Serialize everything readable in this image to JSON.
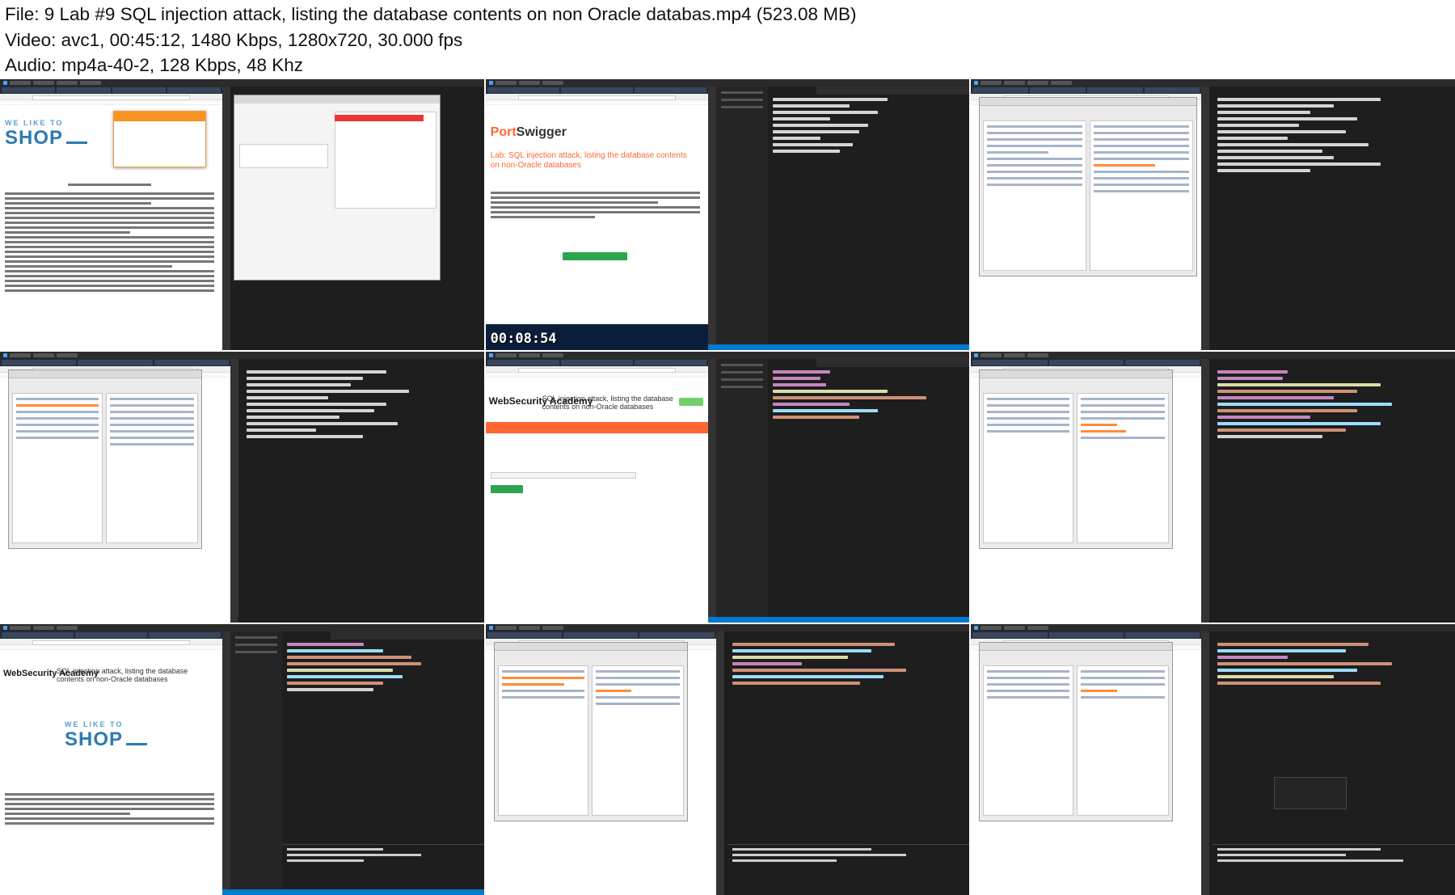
{
  "header": {
    "file_line": "File: 9  Lab #9 SQL injection attack, listing the database contents on non Oracle databas.mp4 (523.08 MB)",
    "video_line": "Video: avc1, 00:45:12, 1480 Kbps, 1280x720, 30.000 fps",
    "audio_line": "Audio: mp4a-40-2, 128 Kbps, 48 Khz"
  },
  "thumbnails": {
    "t1": {
      "shop_tagline": "WE LIKE TO",
      "shop_name": "SHOP"
    },
    "t2": {
      "ps_brand_a": "Port",
      "ps_brand_b": "Swigger",
      "lab_title": "Lab: SQL injection attack, listing the database contents on non-Oracle databases",
      "timer": "00:08:54"
    },
    "t5": {
      "wsa_logo": "WebSecurity Academy",
      "lab_title": "SQL injection attack, listing the database contents on non-Oracle databases"
    },
    "t7": {
      "wsa_logo": "WebSecurity Academy",
      "lab_title": "SQL injection attack, listing the database contents on non-Oracle databases",
      "shop_tagline": "WE LIKE TO",
      "shop_name": "SHOP"
    }
  }
}
